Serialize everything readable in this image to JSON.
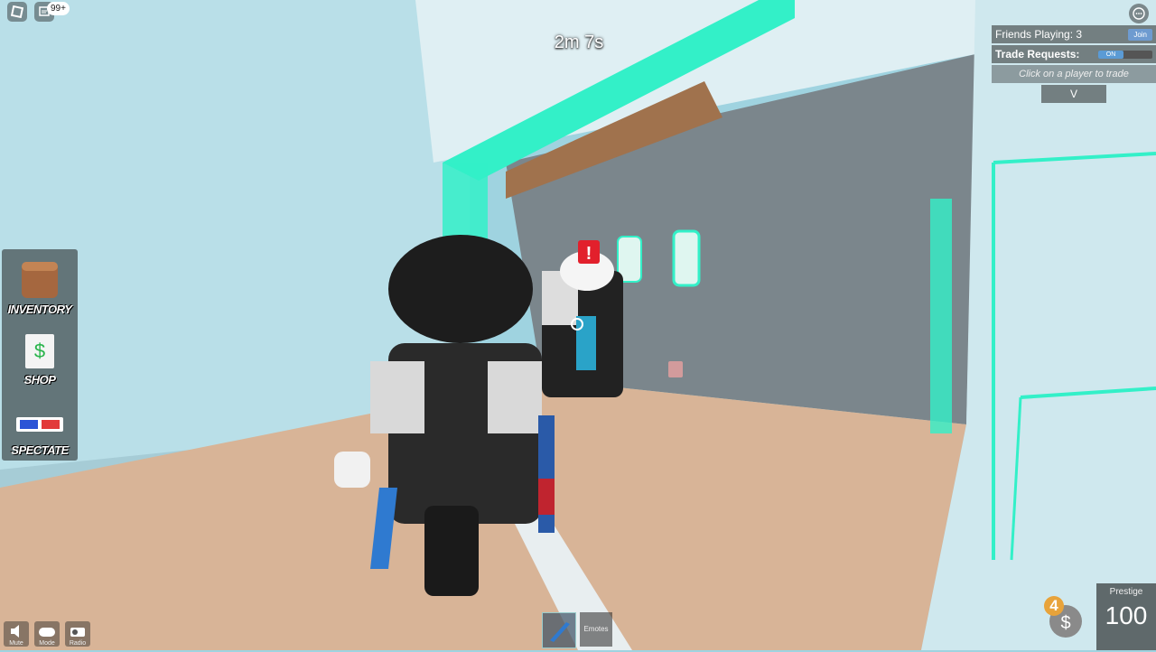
{
  "hud": {
    "timer": "2m 7s",
    "notification_badge": "99+"
  },
  "trade_panel": {
    "friends_playing": "Friends Playing: 3",
    "join_label": "Join",
    "trade_requests_label": "Trade Requests:",
    "toggle_state": "ON",
    "hint": "Click on a player to trade",
    "key": "V"
  },
  "side_menu": {
    "items": [
      {
        "label": "INVENTORY",
        "icon": "crate-icon"
      },
      {
        "label": "SHOP",
        "icon": "shopping-bag-icon"
      },
      {
        "label": "SPECTATE",
        "icon": "3d-glasses-icon"
      }
    ]
  },
  "bottom_left": {
    "buttons": [
      {
        "label": "Mute"
      },
      {
        "label": "Mode"
      },
      {
        "label": "Radio"
      }
    ]
  },
  "hotbar": {
    "slots": [
      {
        "label": "",
        "icon": "knife-icon"
      },
      {
        "label": "Emotes"
      }
    ]
  },
  "currency": {
    "count": "4"
  },
  "prestige": {
    "label": "Prestige",
    "level": "100"
  },
  "colors": {
    "neon": "#33f0c8",
    "wall": "#b8e2ec",
    "floor": "#d9b89a",
    "hud_dark": "#2a2a2a"
  }
}
